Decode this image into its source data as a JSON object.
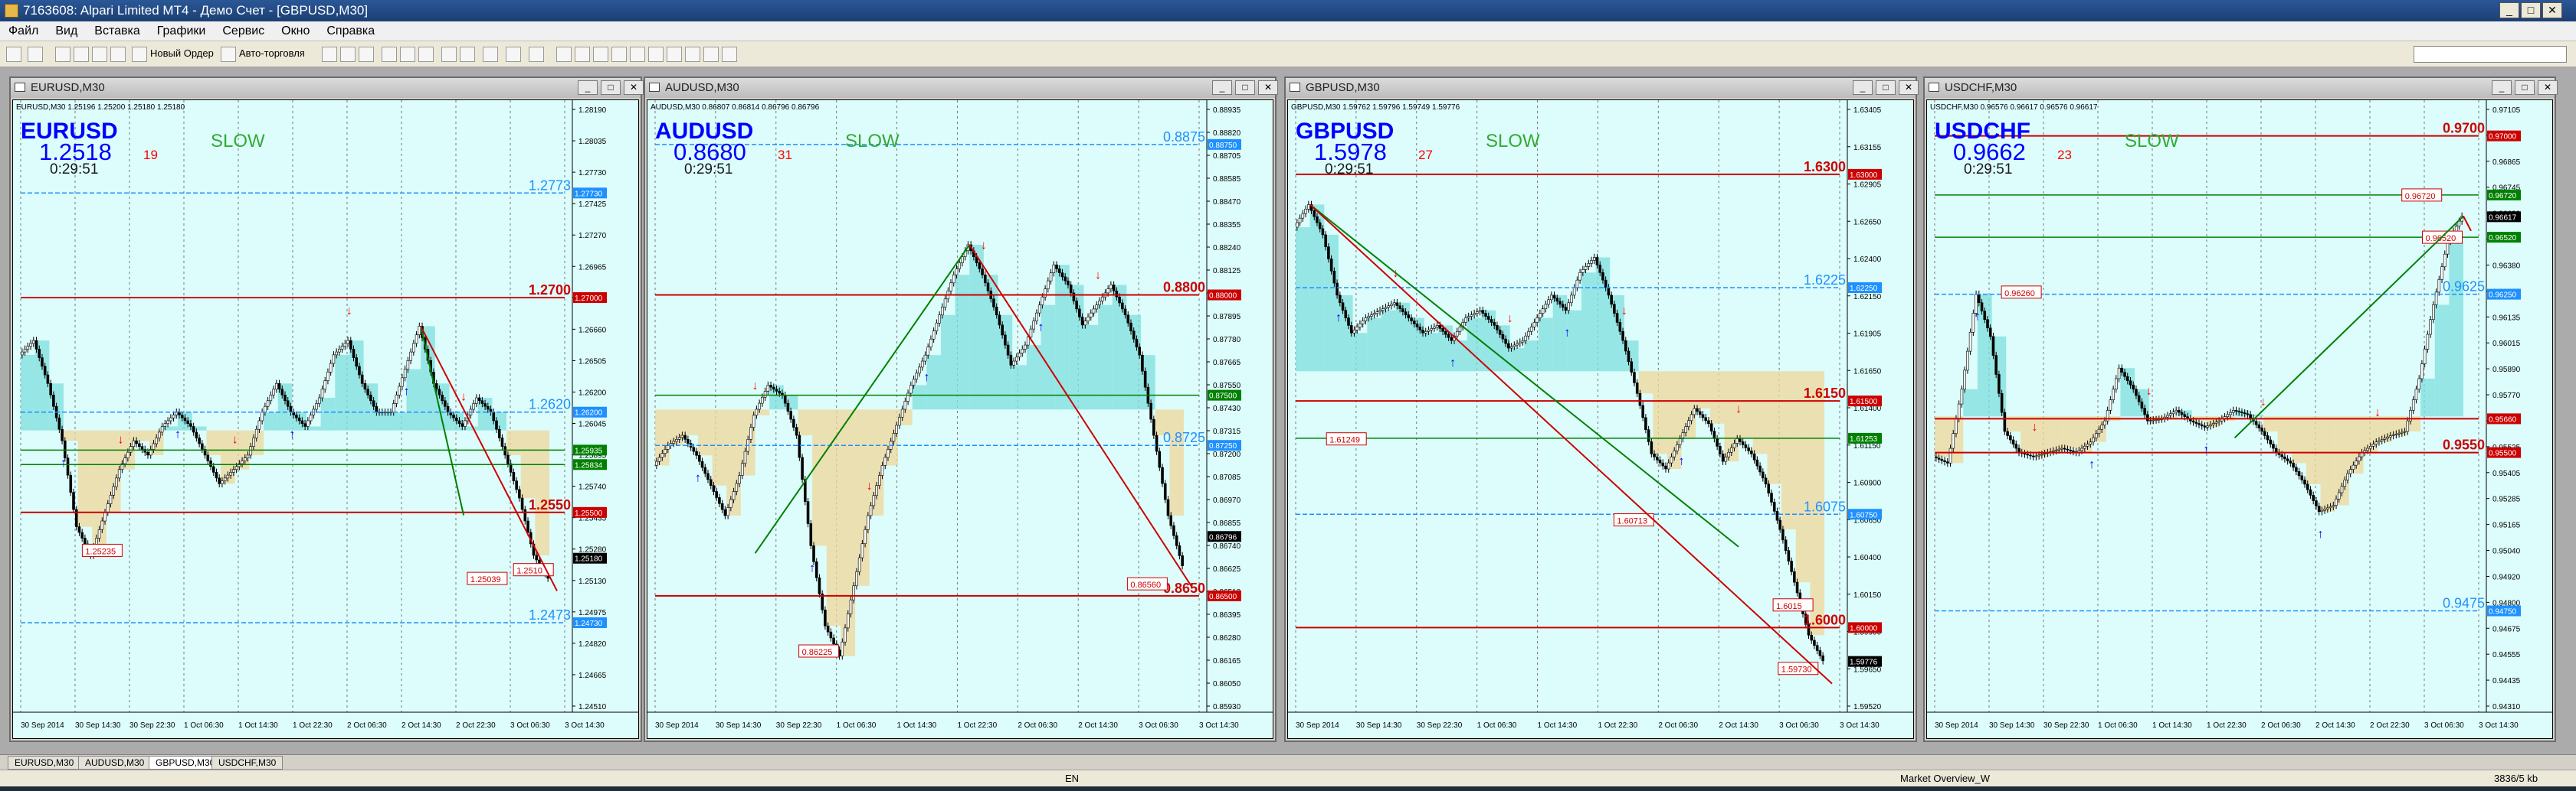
{
  "window": {
    "title": "7163608: Alpari Limited MT4 - Демо Счет - [GBPUSD,M30]"
  },
  "menu": [
    "Файл",
    "Вид",
    "Вставка",
    "Графики",
    "Сервис",
    "Окно",
    "Справка"
  ],
  "toolbar": {
    "new_order": "Новый Ордер",
    "autotrading": "Авто-торговля"
  },
  "charts": [
    {
      "title": "EURUSD,M30",
      "infoline": "EURUSD,M30  1.25196 1.25200 1.25180 1.25180",
      "symbol": "EURUSD",
      "price": "1.2518",
      "seconds": "19",
      "timer": "0:29:51",
      "mode": "SLOW",
      "ymin": 1.24105,
      "ymax": 1.28335,
      "yticks": [
        "1.28190",
        "1.28035",
        "1.27730",
        "1.27425",
        "1.27270",
        "1.26965",
        "1.26815",
        "1.26660",
        "1.26505",
        "1.26200",
        "1.26045",
        "1.25895",
        "1.25740",
        "1.25435",
        "1.25280",
        "1.25130",
        "1.24975",
        "1.24820",
        "1.24665",
        "1.24510"
      ],
      "xticks": [
        "30 Sep 2014",
        "30 Sep 14:30",
        "30 Sep 22:30",
        "1 Oct 06:30",
        "1 Oct 14:30",
        "1 Oct 22:30",
        "2 Oct 06:30",
        "2 Oct 14:30",
        "2 Oct 22:30",
        "3 Oct 06:30",
        "3 Oct 14:30"
      ],
      "boxed_prices": [
        {
          "text": "1.27730",
          "value": 1.2773,
          "color": "#1e90ff"
        },
        {
          "text": "1.27000",
          "value": 1.27,
          "color": "#cc0000"
        },
        {
          "text": "1.26200",
          "value": 1.262,
          "color": "#1e90ff"
        },
        {
          "text": "1.25935",
          "value": 1.25935,
          "color": "#008000"
        },
        {
          "text": "1.25834",
          "value": 1.25834,
          "color": "#008000"
        },
        {
          "text": "1.25500",
          "value": 1.255,
          "color": "#cc0000"
        },
        {
          "text": "1.25180",
          "value": 1.2518,
          "color": "#000000"
        },
        {
          "text": "1.24730",
          "value": 1.2473,
          "color": "#1e90ff"
        }
      ],
      "side_labels": [
        {
          "text": "1.2773",
          "value": 1.2773,
          "color": "#1e90ff"
        },
        {
          "text": "1.2700",
          "value": 1.27,
          "color": "#cc0000"
        },
        {
          "text": "1.2620",
          "value": 1.262,
          "color": "#1e90ff"
        },
        {
          "text": "1.2550",
          "value": 1.255,
          "color": "#cc0000"
        },
        {
          "text": "1.2473",
          "value": 1.2473,
          "color": "#1e90ff"
        }
      ],
      "price_tags": [
        {
          "text": "1.25235",
          "value": 1.25235,
          "x": 0.12
        },
        {
          "text": "1.2510",
          "value": 1.251,
          "x": 0.96
        },
        {
          "text": "1.25039",
          "value": 1.25039,
          "x": 0.87
        }
      ],
      "path": [
        1.266,
        1.267,
        1.264,
        1.26,
        1.254,
        1.252,
        1.255,
        1.258,
        1.26,
        1.259,
        1.261,
        1.262,
        1.261,
        1.259,
        1.257,
        1.258,
        1.259,
        1.262,
        1.264,
        1.262,
        1.261,
        1.263,
        1.266,
        1.267,
        1.264,
        1.262,
        1.262,
        1.265,
        1.268,
        1.264,
        1.262,
        1.261,
        1.263,
        1.262,
        1.259,
        1.256,
        1.252,
        1.2504
      ]
    },
    {
      "title": "AUDUSD,M30",
      "infoline": "AUDUSD,M30  0.86807 0.86814 0.86796 0.86796",
      "symbol": "AUDUSD",
      "price": "0.8680",
      "seconds": "31",
      "timer": "0:29:51",
      "mode": "SLOW",
      "ymin": 0.8592,
      "ymax": 0.8894,
      "yticks": [
        "0.88935",
        "0.88820",
        "0.88705",
        "0.88585",
        "0.88470",
        "0.88355",
        "0.88240",
        "0.88125",
        "0.88010",
        "0.87895",
        "0.87780",
        "0.87665",
        "0.87550",
        "0.87430",
        "0.87315",
        "0.87200",
        "0.87085",
        "0.86970",
        "0.86855",
        "0.86740",
        "0.86625",
        "0.86510",
        "0.86395",
        "0.86280",
        "0.86165",
        "0.86050",
        "0.85930"
      ],
      "xticks": [
        "30 Sep 2014",
        "30 Sep 14:30",
        "30 Sep 22:30",
        "1 Oct 06:30",
        "1 Oct 14:30",
        "1 Oct 22:30",
        "2 Oct 06:30",
        "2 Oct 14:30",
        "3 Oct 06:30",
        "3 Oct 14:30"
      ],
      "boxed_prices": [
        {
          "text": "0.88750",
          "value": 0.8875,
          "color": "#1e90ff"
        },
        {
          "text": "0.88000",
          "value": 0.88,
          "color": "#cc0000"
        },
        {
          "text": "0.87500",
          "value": 0.875,
          "color": "#008000"
        },
        {
          "text": "0.87250",
          "value": 0.8725,
          "color": "#1e90ff"
        },
        {
          "text": "0.86796",
          "value": 0.86796,
          "color": "#000000"
        },
        {
          "text": "0.86500",
          "value": 0.865,
          "color": "#cc0000"
        }
      ],
      "side_labels": [
        {
          "text": "0.8875",
          "value": 0.8875,
          "color": "#1e90ff"
        },
        {
          "text": "0.8800",
          "value": 0.88,
          "color": "#cc0000"
        },
        {
          "text": "0.8725",
          "value": 0.8725,
          "color": "#1e90ff"
        },
        {
          "text": "0.8650",
          "value": 0.865,
          "color": "#cc0000"
        }
      ],
      "price_tags": [
        {
          "text": "0.86225",
          "value": 0.86225,
          "x": 0.28
        },
        {
          "text": "0.86560",
          "value": 0.8656,
          "x": 0.92
        }
      ],
      "path": [
        0.8715,
        0.8725,
        0.873,
        0.872,
        0.8705,
        0.869,
        0.871,
        0.874,
        0.8755,
        0.875,
        0.873,
        0.8675,
        0.8635,
        0.862,
        0.8655,
        0.869,
        0.8715,
        0.8735,
        0.8755,
        0.877,
        0.879,
        0.881,
        0.8825,
        0.881,
        0.879,
        0.8765,
        0.8775,
        0.8795,
        0.8815,
        0.8805,
        0.8785,
        0.8795,
        0.8805,
        0.879,
        0.877,
        0.873,
        0.869,
        0.8665
      ]
    },
    {
      "title": "GBPUSD,M30",
      "infoline": "GBPUSD,M30  1.59762 1.59796 1.59749 1.59776",
      "symbol": "GBPUSD",
      "price": "1.5978",
      "seconds": "27",
      "timer": "0:29:51",
      "mode": "SLOW",
      "ymin": 1.5944,
      "ymax": 1.6345,
      "yticks": [
        "1.63405",
        "1.63155",
        "1.62905",
        "1.62650",
        "1.62400",
        "1.62150",
        "1.61905",
        "1.61650",
        "1.61400",
        "1.61150",
        "1.60900",
        "1.60650",
        "1.60400",
        "1.60150",
        "1.59900",
        "1.59650",
        "1.59520"
      ],
      "xticks": [
        "30 Sep 2014",
        "30 Sep 14:30",
        "30 Sep 22:30",
        "1 Oct 06:30",
        "1 Oct 14:30",
        "1 Oct 22:30",
        "2 Oct 06:30",
        "2 Oct 14:30",
        "3 Oct 06:30",
        "3 Oct 14:30"
      ],
      "boxed_prices": [
        {
          "text": "1.63000",
          "value": 1.63,
          "color": "#cc0000"
        },
        {
          "text": "1.62250",
          "value": 1.6225,
          "color": "#1e90ff"
        },
        {
          "text": "1.61500",
          "value": 1.615,
          "color": "#cc0000"
        },
        {
          "text": "1.61253",
          "value": 1.61253,
          "color": "#008000"
        },
        {
          "text": "1.60750",
          "value": 1.6075,
          "color": "#1e90ff"
        },
        {
          "text": "1.60000",
          "value": 1.6,
          "color": "#cc0000"
        },
        {
          "text": "1.59776",
          "value": 1.59776,
          "color": "#000000"
        }
      ],
      "side_labels": [
        {
          "text": "1.6300",
          "value": 1.63,
          "color": "#cc0000"
        },
        {
          "text": "1.6225",
          "value": 1.6225,
          "color": "#1e90ff"
        },
        {
          "text": "1.6150",
          "value": 1.615,
          "color": "#cc0000"
        },
        {
          "text": "1.6075",
          "value": 1.6075,
          "color": "#1e90ff"
        },
        {
          "text": "1.6000",
          "value": 1.6,
          "color": "#cc0000"
        }
      ],
      "price_tags": [
        {
          "text": "1.61249",
          "value": 1.61249,
          "x": 0.06
        },
        {
          "text": "1.60713",
          "value": 1.60713,
          "x": 0.62
        },
        {
          "text": "1.6015",
          "value": 1.6015,
          "x": 0.93
        },
        {
          "text": "1.59730",
          "value": 1.5973,
          "x": 0.94
        }
      ],
      "path": [
        1.6265,
        1.628,
        1.626,
        1.622,
        1.6195,
        1.6205,
        1.621,
        1.6215,
        1.6205,
        1.6195,
        1.62,
        1.619,
        1.6205,
        1.621,
        1.62,
        1.6185,
        1.619,
        1.6205,
        1.622,
        1.621,
        1.6235,
        1.6245,
        1.622,
        1.619,
        1.6155,
        1.6115,
        1.6105,
        1.6125,
        1.6145,
        1.6135,
        1.611,
        1.6125,
        1.6115,
        1.6095,
        1.6065,
        1.603,
        1.5995,
        1.5978
      ]
    },
    {
      "title": "USDCHF,M30",
      "infoline": "USDCHF,M30  0.96576 0.96617 0.96576 0.96617",
      "symbol": "USDCHF",
      "price": "0.9662",
      "seconds": "23",
      "timer": "0:29:51",
      "mode": "SLOW",
      "ymin": 0.9427,
      "ymax": 0.9714,
      "yticks": [
        "0.97105",
        "0.96985",
        "0.96865",
        "0.96745",
        "0.96620",
        "0.96500",
        "0.96380",
        "0.96255",
        "0.96135",
        "0.96015",
        "0.95890",
        "0.95770",
        "0.95650",
        "0.95525",
        "0.95405",
        "0.95285",
        "0.95165",
        "0.95040",
        "0.94920",
        "0.94800",
        "0.94675",
        "0.94555",
        "0.94435",
        "0.94310"
      ],
      "xticks": [
        "30 Sep 2014",
        "30 Sep 14:30",
        "30 Sep 22:30",
        "1 Oct 06:30",
        "1 Oct 14:30",
        "1 Oct 22:30",
        "2 Oct 06:30",
        "2 Oct 14:30",
        "2 Oct 22:30",
        "3 Oct 06:30",
        "3 Oct 14:30"
      ],
      "boxed_prices": [
        {
          "text": "0.97000",
          "value": 0.97,
          "color": "#cc0000"
        },
        {
          "text": "0.96720",
          "value": 0.9672,
          "color": "#008000"
        },
        {
          "text": "0.96617",
          "value": 0.96617,
          "color": "#000000"
        },
        {
          "text": "0.96520",
          "value": 0.9652,
          "color": "#008000"
        },
        {
          "text": "0.96250",
          "value": 0.9625,
          "color": "#1e90ff"
        },
        {
          "text": "0.95660",
          "value": 0.9566,
          "color": "#cc0000"
        },
        {
          "text": "0.95500",
          "value": 0.955,
          "color": "#cc0000"
        },
        {
          "text": "0.94750",
          "value": 0.9475,
          "color": "#1e90ff"
        }
      ],
      "side_labels": [
        {
          "text": "0.9700",
          "value": 0.97,
          "color": "#cc0000"
        },
        {
          "text": "0.9625",
          "value": 0.9625,
          "color": "#1e90ff"
        },
        {
          "text": "0.9550",
          "value": 0.955,
          "color": "#cc0000"
        },
        {
          "text": "0.9475",
          "value": 0.9475,
          "color": "#1e90ff"
        }
      ],
      "price_tags": [
        {
          "text": "0.96260",
          "value": 0.9626,
          "x": 0.13
        },
        {
          "text": "0.96720",
          "value": 0.9672,
          "x": 0.91
        },
        {
          "text": "0.96520",
          "value": 0.9652,
          "x": 0.95
        }
      ],
      "path": [
        0.9548,
        0.9545,
        0.958,
        0.9625,
        0.9605,
        0.956,
        0.955,
        0.9548,
        0.955,
        0.9552,
        0.955,
        0.9555,
        0.9565,
        0.959,
        0.958,
        0.9565,
        0.9566,
        0.957,
        0.9565,
        0.9562,
        0.9565,
        0.957,
        0.9568,
        0.956,
        0.955,
        0.9545,
        0.9535,
        0.9522,
        0.9525,
        0.954,
        0.955,
        0.9555,
        0.9558,
        0.956,
        0.9585,
        0.962,
        0.965,
        0.9662
      ]
    }
  ],
  "tabs": [
    "EURUSD,M30",
    "AUDUSD,M30",
    "GBPUSD,M30",
    "USDCHF,M30"
  ],
  "active_tab": "GBPUSD,M30",
  "status": {
    "market_overview": "Market Overview_W",
    "traffic": "3836/5 kb",
    "language": "EN"
  },
  "colors": {
    "plot_bg": "#dcfdfb",
    "bull_candle": "#00aa00",
    "bear_candle": "#000000",
    "cloud_up": "#7fdede",
    "cloud_down": "#f0d59a",
    "resistance": "#cc0000",
    "support": "#008000",
    "magenta_level": "#d0207a",
    "blue_level": "#1e90ff"
  },
  "icons": [
    "app-icon",
    "new-chart-icon",
    "profiles-icon",
    "market-watch-icon",
    "navigator-icon",
    "terminal-icon",
    "tester-icon",
    "new-order-icon",
    "autotrading-icon",
    "bar-chart-icon",
    "candles-icon",
    "line-chart-icon",
    "zoom-in-icon",
    "zoom-out-icon",
    "tile-icon",
    "autoscroll-icon",
    "shift-icon",
    "indicators-icon",
    "periods-icon",
    "templates-icon",
    "cursor-icon",
    "crosshair-icon",
    "vline-icon",
    "hline-icon",
    "trendline-icon",
    "channel-icon",
    "fibo-icon",
    "text-icon",
    "label-icon",
    "arrows-icon"
  ]
}
